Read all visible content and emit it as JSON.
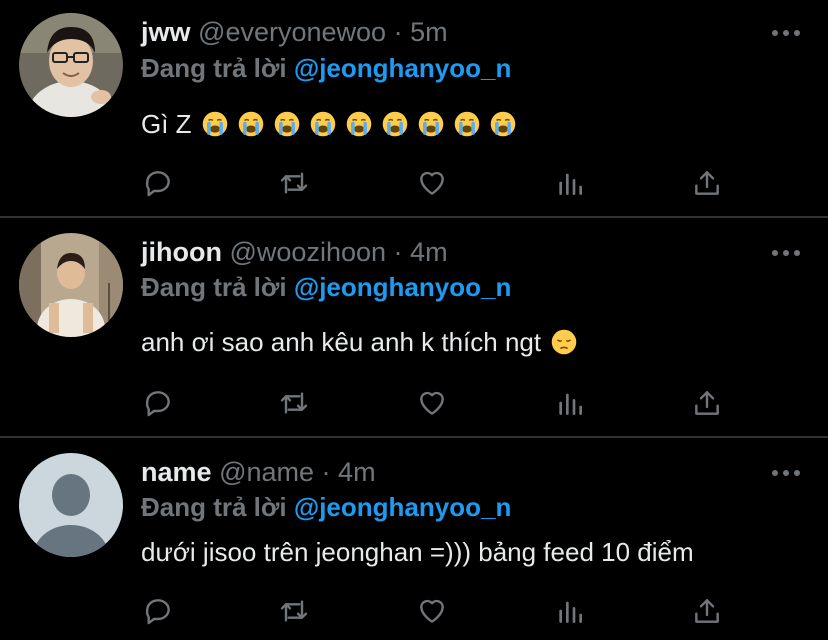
{
  "tweets": [
    {
      "name": "jww",
      "handle": "@everyonewoo",
      "separator": "·",
      "time": "5m",
      "reply_prefix": "Đang trả lời",
      "reply_mention": "@jeonghanyoo_n",
      "text": "Gì Z",
      "emoji_count": 9,
      "emoji": "loudly-crying-face",
      "avatar": "photo-man-glasses"
    },
    {
      "name": "jihoon",
      "handle": "@woozihoon",
      "separator": "·",
      "time": "4m",
      "reply_prefix": "Đang trả lời",
      "reply_mention": "@jeonghanyoo_n",
      "text": "anh ơi sao anh kêu anh k thích ngt",
      "emoji_count": 1,
      "emoji": "pensive-face",
      "avatar": "photo-man-studio"
    },
    {
      "name": "name",
      "handle": "@name",
      "separator": "·",
      "time": "4m",
      "reply_prefix": "Đang trả lời",
      "reply_mention": "@jeonghanyoo_n",
      "text": "dưới jisoo trên jeonghan =))) bảng feed 10 điểm",
      "emoji_count": 0,
      "avatar": "default-profile-silhouette"
    }
  ],
  "colors": {
    "background": "#000000",
    "text": "#e7e9ea",
    "muted": "#71767b",
    "mention": "#1d9bf0",
    "divider": "#2f3336"
  },
  "action_icons": [
    "reply-icon",
    "retweet-icon",
    "like-icon",
    "analytics-icon",
    "share-icon"
  ]
}
